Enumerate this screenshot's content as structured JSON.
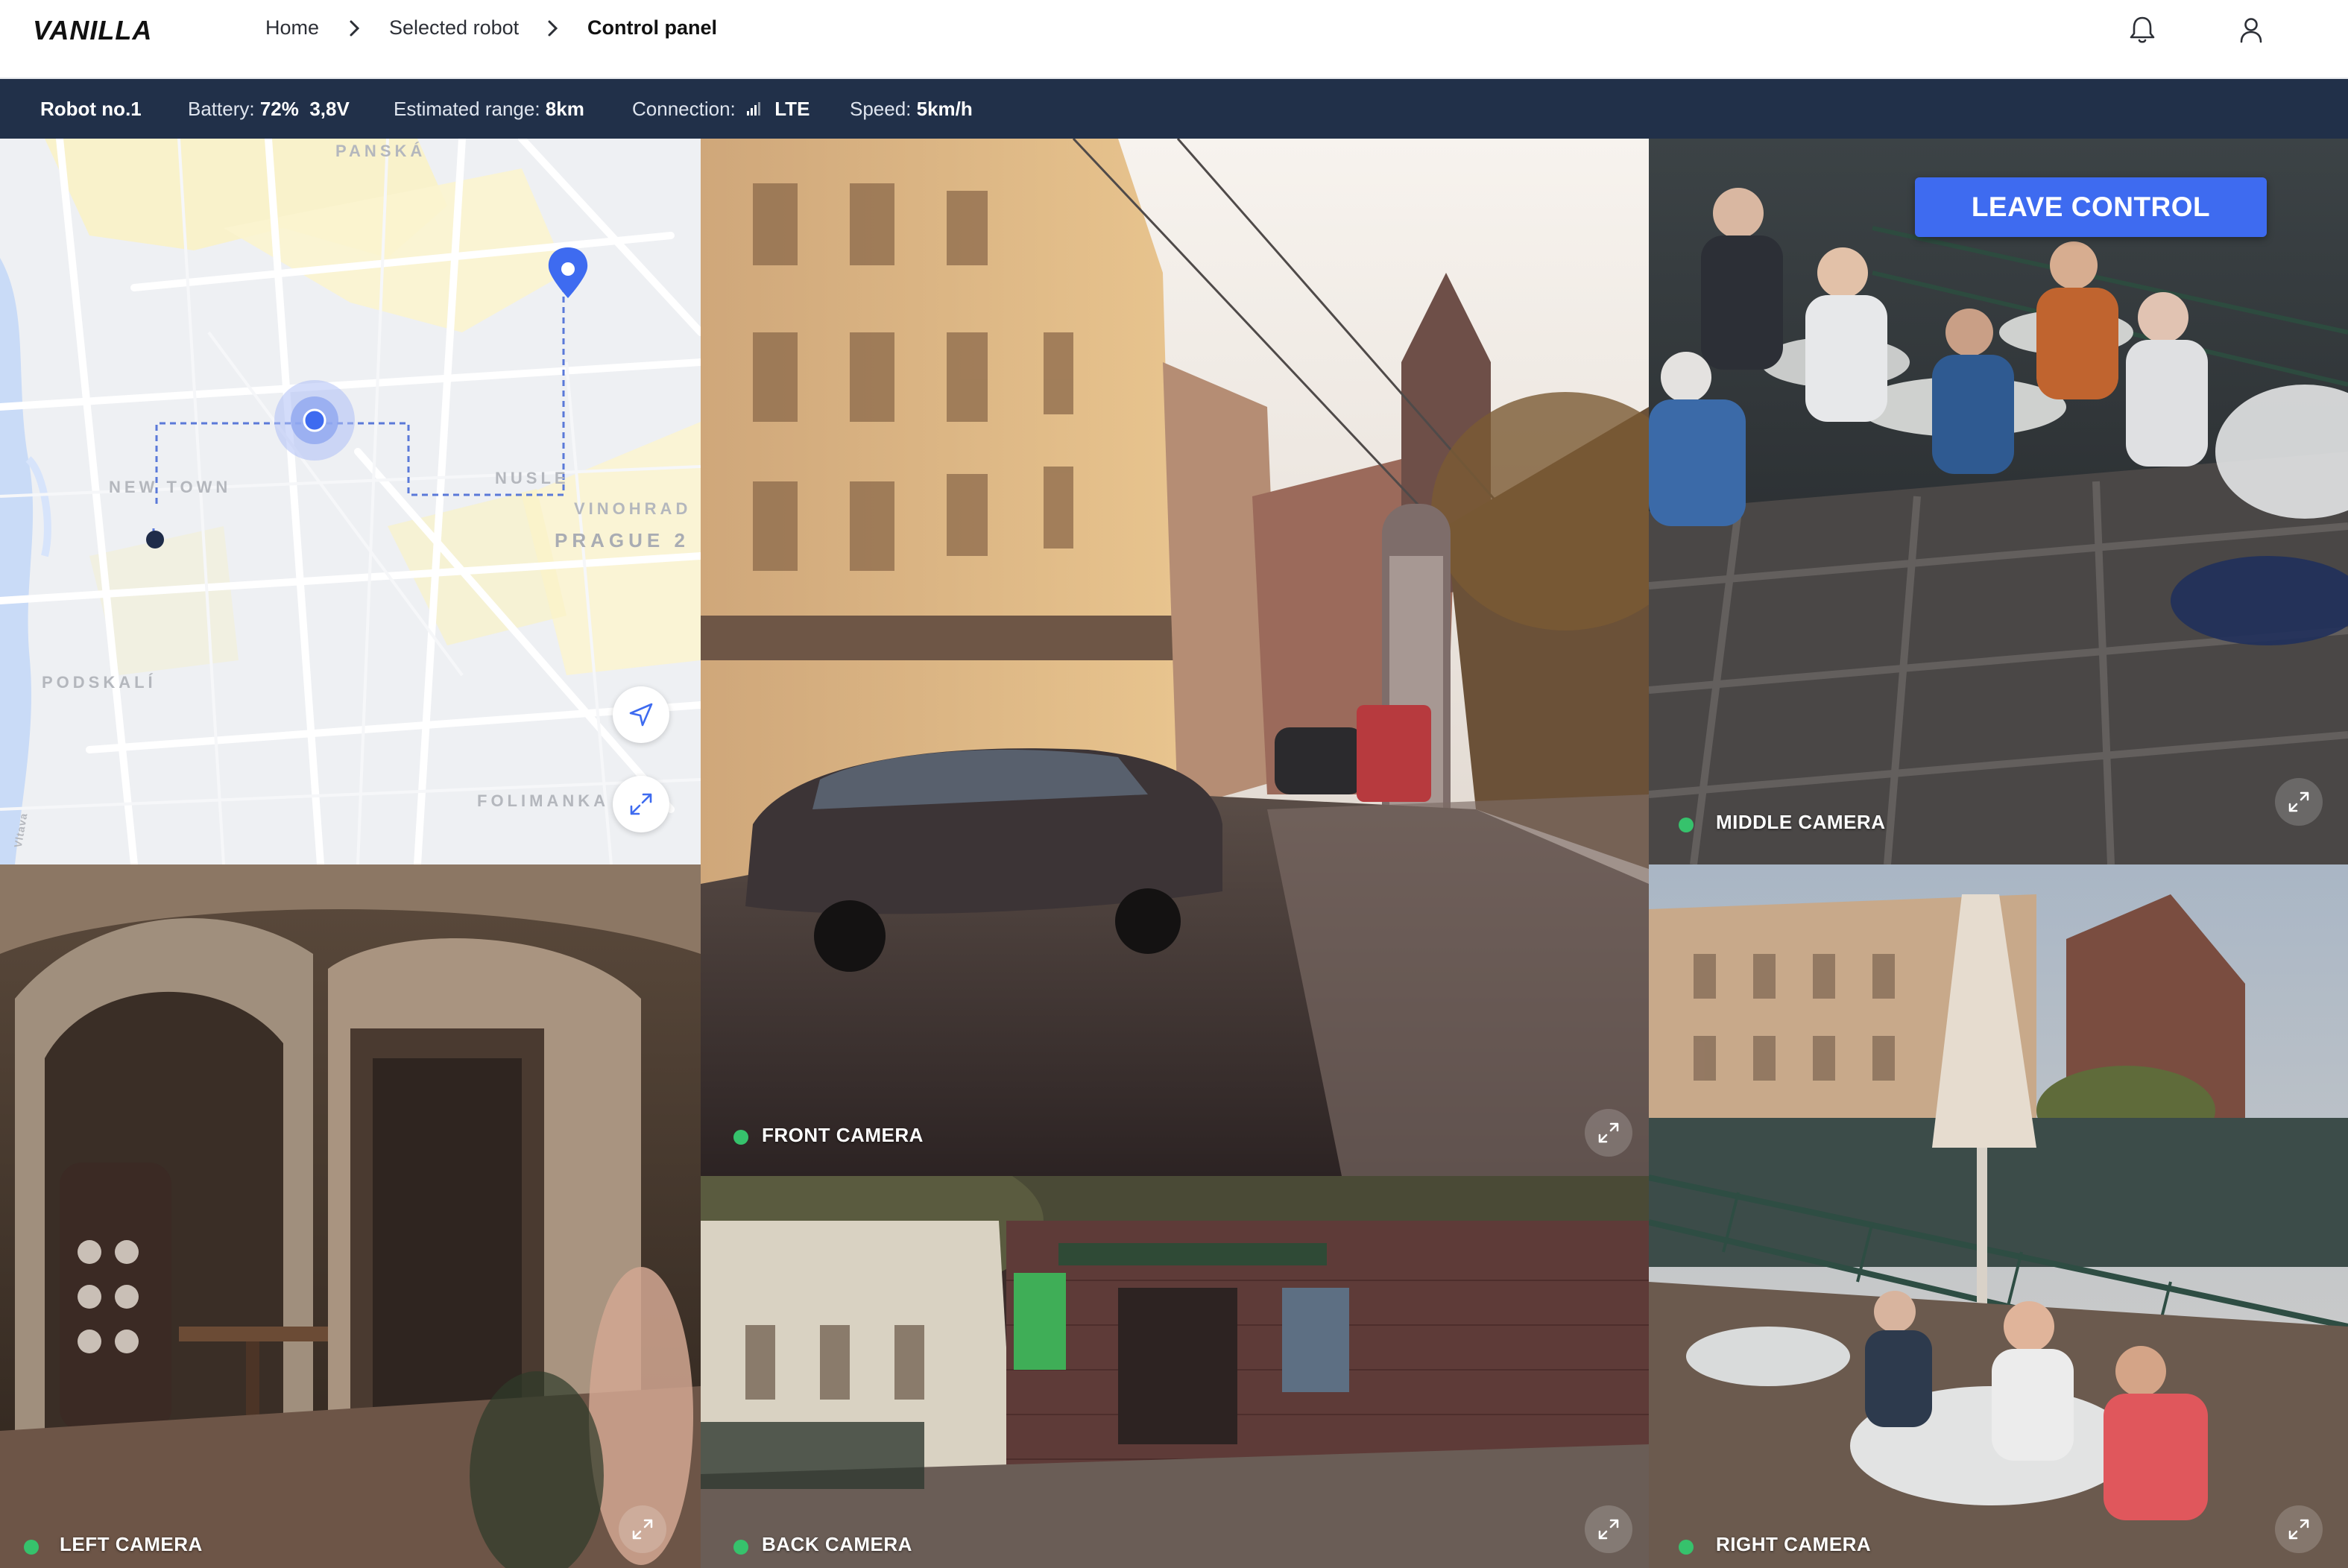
{
  "app": {
    "logo": "VANILLA"
  },
  "breadcrumb": [
    {
      "label": "Home"
    },
    {
      "label": "Selected robot"
    },
    {
      "label": "Control panel"
    }
  ],
  "header_icons": {
    "notifications": "bell-icon",
    "profile": "user-icon"
  },
  "status": {
    "robot_name": "Robot no.1",
    "battery_label": "Battery:",
    "battery_value": "72%  3,8V",
    "range_label": "Estimated range:",
    "range_value": "8km",
    "connection_label": "Connection:",
    "connection_value": "LTE",
    "speed_label": "Speed:",
    "speed_value": "5km/h"
  },
  "map": {
    "labels": {
      "panska": "PANSKÁ",
      "new_town": "NEW TOWN",
      "nusle": "NUSLE",
      "vinohrad": "VINOHRAD",
      "prague2": "PRAGUE 2",
      "podskali": "PODSKALÍ",
      "folimanka": "FOLIMANKA",
      "vltava": "Vltava"
    },
    "locate_icon": "navigation-arrow-icon",
    "expand_icon": "expand-icon"
  },
  "cameras": {
    "front": {
      "label": "FRONT CAMERA",
      "status": "online"
    },
    "middle": {
      "label": "MIDDLE CAMERA",
      "status": "online"
    },
    "left": {
      "label": "LEFT CAMERA",
      "status": "online"
    },
    "back": {
      "label": "BACK CAMERA",
      "status": "online"
    },
    "right": {
      "label": "RIGHT CAMERA",
      "status": "online"
    }
  },
  "leave_control_label": "LEAVE CONTROL",
  "colors": {
    "status_bar": "#213049",
    "accent": "#3e6bf0",
    "online_dot": "#36c26c"
  }
}
